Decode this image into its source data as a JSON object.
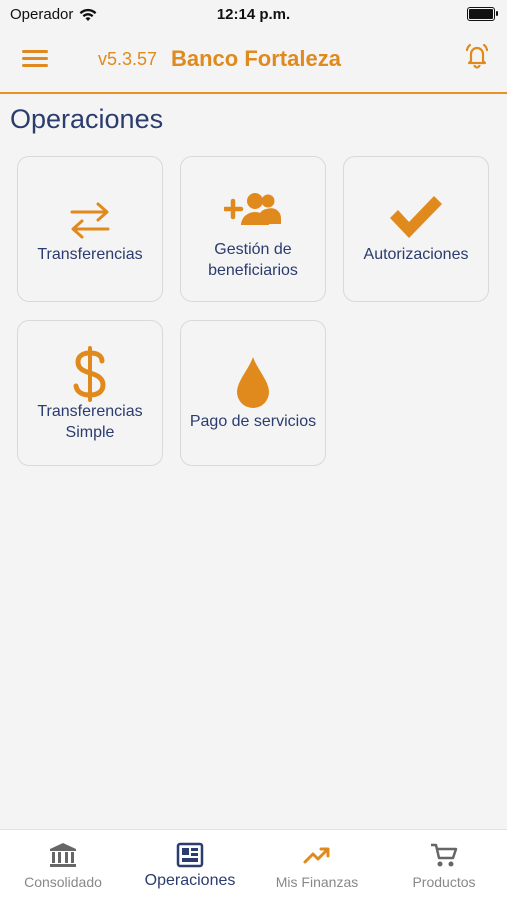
{
  "status": {
    "carrier": "Operador",
    "time": "12:14 p.m."
  },
  "header": {
    "version": "v5.3.57",
    "brand": "Banco Fortaleza"
  },
  "page": {
    "title": "Operaciones"
  },
  "tiles": [
    {
      "label": "Transferencias",
      "icon": "transfer-arrows-icon"
    },
    {
      "label": "Gestión de beneficiarios",
      "icon": "add-user-group-icon"
    },
    {
      "label": "Autorizaciones",
      "icon": "checkmark-icon"
    },
    {
      "label": "Transferencias Simple",
      "icon": "dollar-sign-icon"
    },
    {
      "label": "Pago de servicios",
      "icon": "water-drop-icon"
    }
  ],
  "tabs": [
    {
      "label": "Consolidado",
      "icon": "bank-icon"
    },
    {
      "label": "Operaciones",
      "icon": "operations-icon",
      "active": true
    },
    {
      "label": "Mis Finanzas",
      "icon": "trending-up-icon"
    },
    {
      "label": "Productos",
      "icon": "cart-icon"
    }
  ],
  "colors": {
    "accent": "#e08a1e",
    "navy": "#2b3c6e",
    "inactive": "#888888"
  }
}
